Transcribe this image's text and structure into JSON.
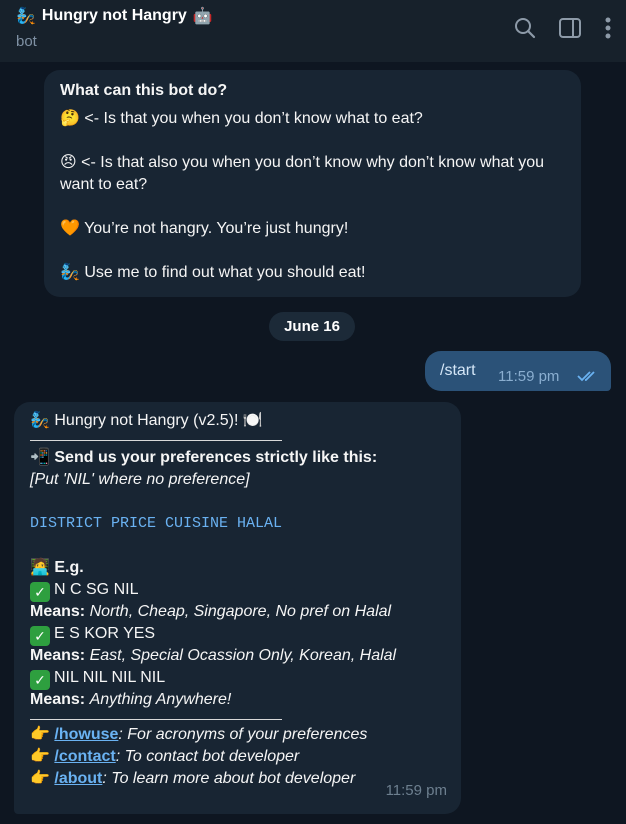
{
  "header": {
    "title": "Hungry not Hangry",
    "title_prefix_emoji": "🧞",
    "title_suffix_emoji": "🤖",
    "subtitle": "bot",
    "icons": [
      "search-icon",
      "sidebar-toggle-icon",
      "more-vertical-icon"
    ]
  },
  "info_card": {
    "title": "What can this bot do?",
    "lines": [
      {
        "emoji": "🤔",
        "text": "<- Is that you when you don’t know what to eat?"
      },
      {
        "emoji": "😠",
        "text": "<- Is that also you when you don’t know why don’t know what you want to eat?"
      },
      {
        "emoji": "🧡",
        "text": "You’re not hangry. You’re just hungry!"
      },
      {
        "emoji": "🧞",
        "text": "Use me to find out what you should eat!"
      }
    ]
  },
  "date_pill": "June 16",
  "outgoing": {
    "text": "/start",
    "time": "11:59 pm"
  },
  "bot_message": {
    "heading": "Hungry not Hangry (v2.5)!",
    "heading_emoji_left": "🧞",
    "heading_emoji_right": "🍽️",
    "send_emoji": "📲",
    "send_label": "Send us your preferences strictly like this:",
    "nil_note": "[Put 'NIL' where no preference]",
    "format": "DISTRICT PRICE CUISINE HALAL",
    "eg_emoji": "🧑‍💻",
    "eg_label": "E.g.",
    "examples": [
      {
        "code": "N C SG NIL",
        "means_label": "Means:",
        "means": "North, Cheap, Singapore, No pref on Halal"
      },
      {
        "code": "E S KOR YES",
        "means_label": "Means:",
        "means": "East, Special Ocassion Only, Korean, Halal"
      },
      {
        "code": "NIL NIL NIL NIL",
        "means_label": "Means:",
        "means": "Anything Anywhere!"
      }
    ],
    "commands": [
      {
        "cmd": "/howuse",
        "desc": ": For acronyms of your preferences"
      },
      {
        "cmd": "/contact",
        "desc": ": To contact bot developer"
      },
      {
        "cmd": "/about",
        "desc": ": To learn more about bot developer"
      }
    ],
    "point_emoji": "👉",
    "time": "11:59 pm"
  },
  "colors": {
    "background": "#0e1621",
    "header": "#17212b",
    "incoming_bubble": "#182533",
    "outgoing_bubble": "#2b5278",
    "link": "#6ab2f2",
    "check_green": "#2e9f3f"
  }
}
